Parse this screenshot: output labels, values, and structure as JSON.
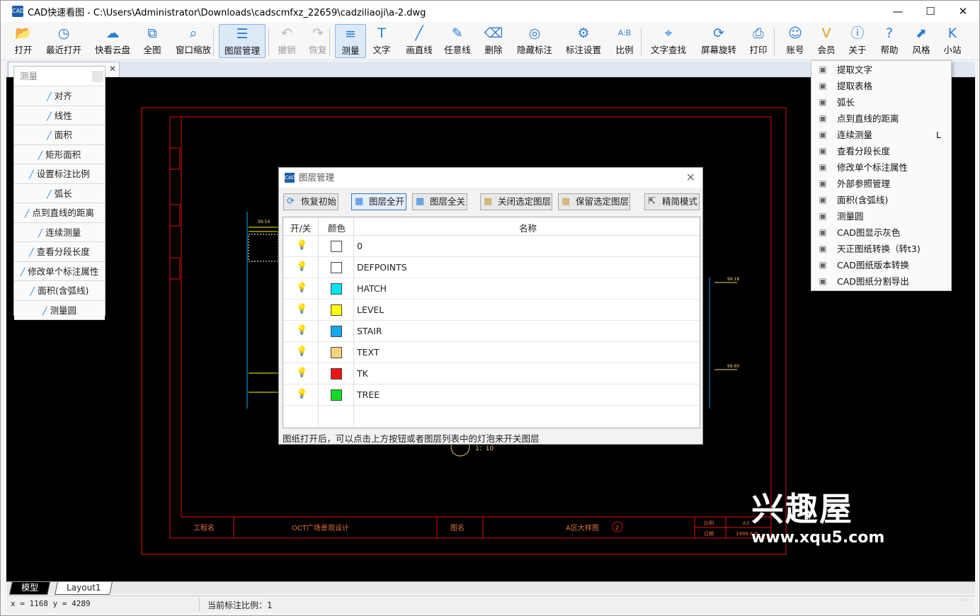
{
  "window": {
    "title": "CAD快速看图 - C:\\Users\\Administrator\\Downloads\\cadscmfxz_22659\\cadziliaoji\\a-2.dwg",
    "app_icon_text": "CAD"
  },
  "toolbar": [
    {
      "label": "打开",
      "icon": "folder-open"
    },
    {
      "label": "最近打开",
      "icon": "clock"
    },
    {
      "label": "快看云盘",
      "icon": "cloud"
    },
    {
      "label": "全图",
      "icon": "fit-all"
    },
    {
      "label": "窗口缩放",
      "icon": "zoom-window"
    },
    {
      "label": "图层管理",
      "icon": "layers",
      "selected": true
    },
    {
      "label": "撤销",
      "icon": "undo",
      "disabled": true
    },
    {
      "label": "恢复",
      "icon": "redo",
      "disabled": true
    },
    {
      "label": "测量",
      "icon": "ruler",
      "selected": true
    },
    {
      "label": "文字",
      "icon": "text-t"
    },
    {
      "label": "画直线",
      "icon": "line"
    },
    {
      "label": "任意线",
      "icon": "pen"
    },
    {
      "label": "删除",
      "icon": "eraser"
    },
    {
      "label": "隐藏标注",
      "icon": "eye-hidden"
    },
    {
      "label": "标注设置",
      "icon": "annotation-settings"
    },
    {
      "label": "比例",
      "icon": "scale"
    },
    {
      "label": "文字查找",
      "icon": "text-search"
    },
    {
      "label": "屏幕旋转",
      "icon": "rotate-screen"
    },
    {
      "label": "打印",
      "icon": "printer"
    },
    {
      "label": "账号",
      "icon": "user"
    },
    {
      "label": "会员",
      "icon": "vip"
    },
    {
      "label": "关于",
      "icon": "info"
    },
    {
      "label": "帮助",
      "icon": "help"
    },
    {
      "label": "风格",
      "icon": "style"
    },
    {
      "label": "小站",
      "icon": "site"
    }
  ],
  "measure_panel": {
    "title": "测量",
    "items": [
      "对齐",
      "线性",
      "面积",
      "矩形面积",
      "设置标注比例",
      "弧长",
      "点到直线的距离",
      "连续测量",
      "查看分段长度",
      "修改单个标注属性",
      "面积(含弧线)",
      "测量圆"
    ]
  },
  "dropdown_menu": [
    {
      "label": "提取文字"
    },
    {
      "label": "提取表格"
    },
    {
      "label": "弧长"
    },
    {
      "label": "点到直线的距离"
    },
    {
      "label": "连续测量",
      "shortcut": "L"
    },
    {
      "label": "查看分段长度"
    },
    {
      "label": "修改单个标注属性"
    },
    {
      "label": "外部参照管理"
    },
    {
      "label": "面积(含弧线)"
    },
    {
      "label": "测量圆"
    },
    {
      "label": "CAD图显示灰色"
    },
    {
      "label": "天正图纸转换（转t3)"
    },
    {
      "label": "CAD图纸版本转换"
    },
    {
      "label": "CAD图纸分割导出"
    }
  ],
  "layer_dialog": {
    "title": "图层管理",
    "buttons": {
      "reset": "恢复初始",
      "all_on": "图层全开",
      "all_off": "图层全关",
      "close_selected": "关闭选定图层",
      "keep_selected": "保留选定图层",
      "simple_mode": "精简模式"
    },
    "columns": {
      "toggle": "开/关",
      "color": "颜色",
      "name": "名称"
    },
    "layers": [
      {
        "name": "0",
        "color": "#ffffff"
      },
      {
        "name": "DEFPOINTS",
        "color": "#ffffff"
      },
      {
        "name": "HATCH",
        "color": "#00e5f0"
      },
      {
        "name": "LEVEL",
        "color": "#ffff00"
      },
      {
        "name": "STAIR",
        "color": "#1aa6ee"
      },
      {
        "name": "TEXT",
        "color": "#f7d27e"
      },
      {
        "name": "TK",
        "color": "#ee1111"
      },
      {
        "name": "TREE",
        "color": "#11dd22"
      }
    ],
    "tip": "图纸打开后，可以点击上方按钮或者图层列表中的灯泡来开关图层"
  },
  "drawing": {
    "title_block": {
      "project_label": "工程名",
      "project": "OCT广场景观设计",
      "drawing_label": "图名",
      "drawing": "A区大样图",
      "number": "2",
      "scale_label": "比例",
      "scale": "A3",
      "date_label": "日期",
      "date": "1999.6.6"
    },
    "level_marks": [
      "99.54",
      "99.18",
      "99.60"
    ],
    "detail_scale": "1：10"
  },
  "bottom_tabs": [
    "模型",
    "Layout1"
  ],
  "statusbar": {
    "coords": "x = 1168  y = 4289",
    "scale_text": "当前标注比例：1"
  },
  "watermark": {
    "brand": "兴趣屋",
    "url": "www.xqu5.com"
  }
}
